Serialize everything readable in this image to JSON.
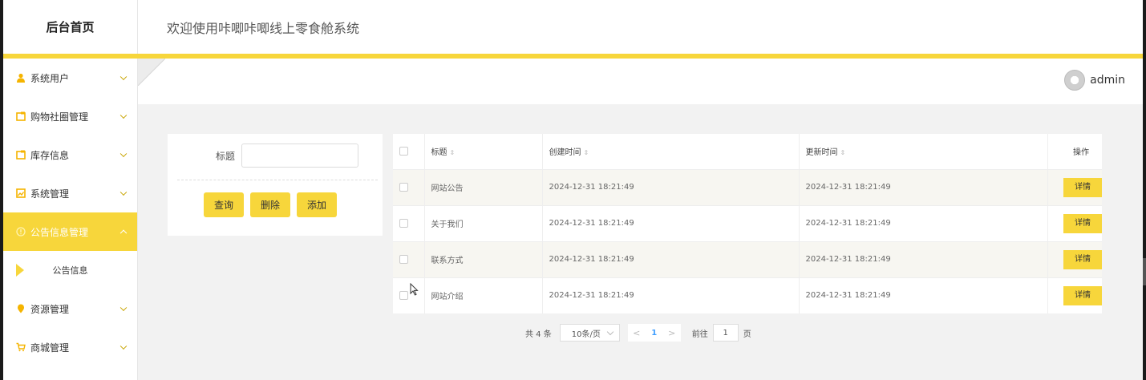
{
  "brand": {
    "title": "后台首页"
  },
  "header": {
    "welcome": "欢迎使用咔唧咔唧线上零食舱系统"
  },
  "user": {
    "name": "admin"
  },
  "sidebar": {
    "items": [
      {
        "label": "系统用户",
        "icon": "user-icon"
      },
      {
        "label": "购物社圈管理",
        "icon": "folder-icon"
      },
      {
        "label": "库存信息",
        "icon": "folder-icon"
      },
      {
        "label": "系统管理",
        "icon": "image-icon"
      },
      {
        "label": "公告信息管理",
        "icon": "info-icon",
        "active": true
      },
      {
        "label": "资源管理",
        "icon": "location-icon"
      },
      {
        "label": "商城管理",
        "icon": "cart-icon"
      }
    ],
    "sub_item": "公告信息"
  },
  "search": {
    "label": "标题",
    "placeholder": "",
    "value": "",
    "query_button": "查询",
    "delete_button": "删除",
    "add_button": "添加"
  },
  "table": {
    "headers": {
      "title": "标题",
      "created": "创建时间",
      "updated": "更新时间",
      "actions": "操作"
    },
    "sort_glyph": "⇕",
    "detail_label": "详情",
    "rows": [
      {
        "title": "网站公告",
        "created": "2024-12-31 18:21:49",
        "updated": "2024-12-31 18:21:49"
      },
      {
        "title": "关于我们",
        "created": "2024-12-31 18:21:49",
        "updated": "2024-12-31 18:21:49"
      },
      {
        "title": "联系方式",
        "created": "2024-12-31 18:21:49",
        "updated": "2024-12-31 18:21:49"
      },
      {
        "title": "网站介绍",
        "created": "2024-12-31 18:21:49",
        "updated": "2024-12-31 18:21:49"
      }
    ]
  },
  "pagination": {
    "total": "共 4 条",
    "page_size": "10条/页",
    "prev": "<",
    "current_page": "1",
    "next": ">",
    "goto_label": "前往",
    "goto_value": "1",
    "page_suffix": "页"
  },
  "colors": {
    "accent": "#f7d63b",
    "page_bg": "#f2f2f2",
    "link": "#409eff"
  }
}
